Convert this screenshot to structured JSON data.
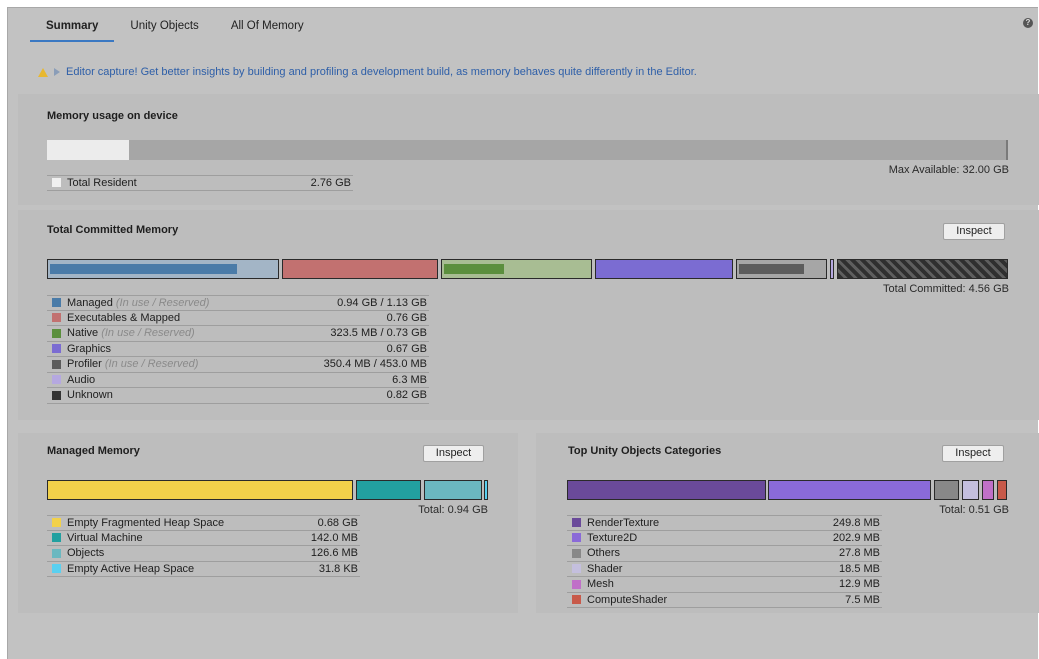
{
  "tabs": [
    {
      "label": "Summary"
    },
    {
      "label": "Unity Objects"
    },
    {
      "label": "All Of Memory"
    }
  ],
  "help_icon": "help-icon",
  "notice": {
    "text": "Editor capture! Get better insights by building and profiling a development build, as memory behaves quite differently in the Editor.",
    "icons": [
      "warning-icon",
      "play-icon"
    ]
  },
  "device_memory": {
    "title": "Memory usage on device",
    "resident_fraction": 0.086,
    "max_available_label": "Max Available: 32.00 GB",
    "legend": [
      {
        "name": "Total Resident",
        "value": "2.76 GB",
        "color": "#f0f0f0"
      }
    ]
  },
  "committed": {
    "title": "Total Committed Memory",
    "inspect_label": "Inspect",
    "total_label": "Total Committed: 4.56 GB",
    "legend": [
      {
        "name": "Managed",
        "hint": "(In use / Reserved)",
        "value": "0.94 GB / 1.13 GB",
        "color": "#4a7ba8",
        "used_fraction": 0.83,
        "reserved_bg": "#a3b5c6"
      },
      {
        "name": "Executables & Mapped",
        "hint": "",
        "value": "0.76 GB",
        "color": "#c27170",
        "used_fraction": 1,
        "reserved_bg": "#c27170"
      },
      {
        "name": "Native",
        "hint": "(In use / Reserved)",
        "value": "323.5 MB / 0.73 GB",
        "color": "#5b8f3d",
        "used_fraction": 0.43,
        "reserved_bg": "#a8bd93"
      },
      {
        "name": "Graphics",
        "hint": "",
        "value": "0.67 GB",
        "color": "#7b6cd2",
        "used_fraction": 1,
        "reserved_bg": "#7b6cd2"
      },
      {
        "name": "Profiler",
        "hint": "(In use / Reserved)",
        "value": "350.4 MB / 453.0 MB",
        "color": "#5c5c5c",
        "used_fraction": 0.77,
        "reserved_bg": "#a6a6a6"
      },
      {
        "name": "Audio",
        "hint": "",
        "value": "6.3 MB",
        "color": "#b5a8e0",
        "used_fraction": 1,
        "reserved_bg": "#b5a8e0"
      },
      {
        "name": "Unknown",
        "hint": "",
        "value": "0.82 GB",
        "color": "#333333",
        "used_fraction": 1,
        "reserved_bg": "#333333"
      }
    ]
  },
  "managed": {
    "title": "Managed Memory",
    "inspect_label": "Inspect",
    "total_label": "Total: 0.94 GB",
    "legend": [
      {
        "name": "Empty Fragmented Heap Space",
        "value": "0.68 GB",
        "color": "#f2d14a"
      },
      {
        "name": "Virtual Machine",
        "value": "142.0 MB",
        "color": "#22a0a0"
      },
      {
        "name": "Objects",
        "value": "126.6 MB",
        "color": "#6bb8c0"
      },
      {
        "name": "Empty Active Heap Space",
        "value": "31.8 KB",
        "color": "#5ad0f0"
      }
    ]
  },
  "unity_objects": {
    "title": "Top Unity Objects Categories",
    "inspect_label": "Inspect",
    "total_label": "Total: 0.51 GB",
    "legend": [
      {
        "name": "RenderTexture",
        "value": "249.8 MB",
        "color": "#6a4a9a"
      },
      {
        "name": "Texture2D",
        "value": "202.9 MB",
        "color": "#8a6ad8"
      },
      {
        "name": "Others",
        "value": "27.8 MB",
        "color": "#888888"
      },
      {
        "name": "Shader",
        "value": "18.5 MB",
        "color": "#c4bfde"
      },
      {
        "name": "Mesh",
        "value": "12.9 MB",
        "color": "#c070c8"
      },
      {
        "name": "ComputeShader",
        "value": "7.5 MB",
        "color": "#c85a4a"
      }
    ]
  }
}
